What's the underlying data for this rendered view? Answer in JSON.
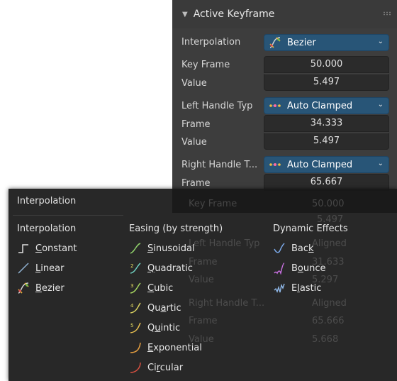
{
  "panel": {
    "title": "Active Keyframe",
    "interpolation_label": "Interpolation",
    "interpolation_value": "Bezier",
    "key_frame_label": "Key Frame",
    "key_frame_value": "50.000",
    "value_label": "Value",
    "value_value": "5.497",
    "left_handle_label": "Left Handle Typ",
    "left_handle_value": "Auto Clamped",
    "left_frame_label": "Frame",
    "left_frame_value": "34.333",
    "left_value_label": "Value",
    "left_value_value": "5.497",
    "right_handle_label": "Right Handle T...",
    "right_handle_value": "Auto Clamped",
    "right_frame_label": "Frame",
    "right_frame_value": "65.667"
  },
  "ghost": {
    "key_frame_label": "Key Frame",
    "key_frame_value": "50.000",
    "value_value": "5.497",
    "left_handle_label": "Left Handle Typ",
    "left_handle_value": "Aligned",
    "frame_label": "Frame",
    "frame_value": "31.633",
    "value_label": "Value",
    "value_value2": "5.297",
    "right_handle_label": "Right Handle T...",
    "right_handle_value": "Aligned",
    "frame2_label": "Frame",
    "frame2_value": "65.666",
    "value2_label": "Value",
    "value2_value": "5.668"
  },
  "menu": {
    "title": "Interpolation",
    "columns": {
      "interpolation": {
        "heading": "Interpolation",
        "items": [
          {
            "key": "C",
            "rest": "onstant",
            "icon": "constant-icon"
          },
          {
            "key": "L",
            "rest": "inear",
            "icon": "linear-icon"
          },
          {
            "key": "B",
            "rest": "ezier",
            "icon": "bezier-icon"
          }
        ]
      },
      "easing": {
        "heading": "Easing (by strength)",
        "items": [
          {
            "key": "S",
            "rest": "inusoidal",
            "icon": "sinusoidal-icon"
          },
          {
            "key": "Q",
            "rest": "uadratic",
            "icon": "quadratic-icon"
          },
          {
            "key": "C",
            "rest": "ubic",
            "icon": "cubic-icon"
          },
          {
            "key": "",
            "pre": "Qu",
            "mid": "a",
            "rest": "rtic",
            "icon": "quartic-icon"
          },
          {
            "key": "",
            "pre": "Q",
            "mid": "u",
            "rest": "intic",
            "icon": "quintic-icon"
          },
          {
            "key": "E",
            "rest": "xponential",
            "icon": "exponential-icon"
          },
          {
            "key": "",
            "pre": "Ci",
            "mid": "r",
            "rest": "cular",
            "icon": "circular-icon"
          }
        ]
      },
      "dynamic": {
        "heading": "Dynamic Effects",
        "items": [
          {
            "key": "",
            "pre": "Bac",
            "mid": "k",
            "rest": "",
            "icon": "back-icon"
          },
          {
            "key": "",
            "pre": "B",
            "mid": "o",
            "rest": "unce",
            "icon": "bounce-icon"
          },
          {
            "key": "",
            "pre": "E",
            "mid": "l",
            "rest": "astic",
            "icon": "elastic-icon"
          }
        ]
      }
    }
  },
  "colors": {
    "panel_bg": "#3d3d3d",
    "dropdown_blue": "#285577",
    "field_bg": "#2b2b2b",
    "menu_bg": "#181818"
  }
}
